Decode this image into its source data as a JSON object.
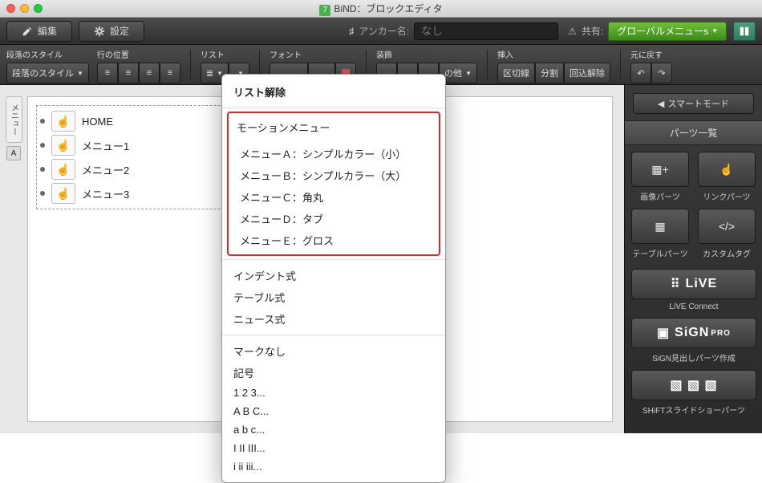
{
  "window": {
    "title": "BiND：ブロックエディタ",
    "badge": "7"
  },
  "toolbar1": {
    "edit_label": "編集",
    "settings_label": "設定",
    "anchor_prefix": "♯",
    "anchor_label": "アンカー名:",
    "anchor_placeholder": "なし",
    "share_label": "共有:",
    "share_button": "グローバルメニューs"
  },
  "toolbar2": {
    "para_style_label": "段落のスタイル",
    "para_style_value": "段落のスタイル",
    "line_pos_label": "行の位置",
    "list_label": "リスト",
    "font_label": "フォント",
    "decoration_label": "装飾",
    "decoration_more": "の他",
    "insert_label": "挿入",
    "insert_buttons": [
      "区切線",
      "分割",
      "回込解除"
    ],
    "undo_label": "元に戻す"
  },
  "canvas": {
    "side_tab_label": "メニュー",
    "side_tab_badge": "A",
    "items": [
      {
        "label": "HOME"
      },
      {
        "label": "メニュー1"
      },
      {
        "label": "メニュー2"
      },
      {
        "label": "メニュー3"
      }
    ]
  },
  "dropdown": {
    "header": "リスト解除",
    "motion_title": "モーションメニュー",
    "motion_items": [
      "メニューＡ：シンプルカラー（小）",
      "メニューＢ：シンプルカラー（大）",
      "メニューＣ：角丸",
      "メニューＤ：タブ",
      "メニューＥ：グロス"
    ],
    "style_items": [
      "インデント式",
      "テーブル式",
      "ニュース式"
    ],
    "mark_items": [
      "マークなし",
      "記号",
      "1 2 3...",
      "A B C...",
      "a b c...",
      "I II III...",
      "i ii iii..."
    ]
  },
  "rightpanel": {
    "smart_mode": "スマートモード",
    "header": "パーツ一覧",
    "parts_small": [
      {
        "label": "画像パーツ"
      },
      {
        "label": "リンクパーツ"
      },
      {
        "label": "テーブルパーツ"
      },
      {
        "label": "カスタムタグ"
      }
    ],
    "live_title": "LiVE",
    "live_label": "LiVE Connect",
    "sign_title": "SiGN",
    "sign_suffix": "PRO",
    "sign_label": "SiGN見出しパーツ作成",
    "shift_label": "SHiFTスライドショーパーツ"
  }
}
